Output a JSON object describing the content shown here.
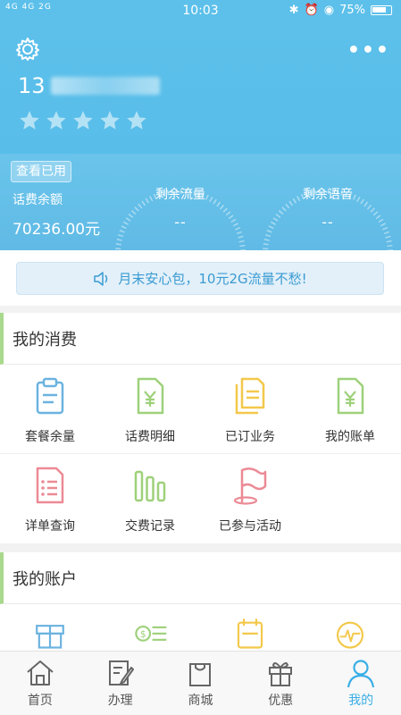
{
  "status_bar": {
    "signal": "4G 4G 2G",
    "time": "10:03",
    "battery": "75%"
  },
  "header": {
    "phone_visible": "13",
    "rating_stars": 5,
    "check_usage_label": "查看已用",
    "balance_label": "话费余额",
    "balance_value": "70236.00元",
    "data_label": "剩余流量",
    "data_value": "--",
    "voice_label": "剩余语音",
    "voice_value": "--"
  },
  "notice": {
    "text": "月末安心包，10元2G流量不愁!"
  },
  "consumption": {
    "title": "我的消费",
    "items": [
      {
        "label": "套餐余量",
        "icon": "clipboard-icon",
        "color": "#6bb3e0"
      },
      {
        "label": "话费明细",
        "icon": "yuan-document-icon",
        "color": "#9ed17a"
      },
      {
        "label": "已订业务",
        "icon": "documents-icon",
        "color": "#f3c84a"
      },
      {
        "label": "我的账单",
        "icon": "yuan-bill-icon",
        "color": "#9ed17a"
      },
      {
        "label": "详单查询",
        "icon": "list-document-icon",
        "color": "#ec8a95"
      },
      {
        "label": "交费记录",
        "icon": "bars-icon",
        "color": "#9ed17a"
      },
      {
        "label": "已参与活动",
        "icon": "flag-icon",
        "color": "#ec8a95"
      }
    ]
  },
  "account": {
    "title": "我的账户",
    "items": [
      {
        "icon": "gift-table-icon",
        "color": "#6bb3e0"
      },
      {
        "icon": "money-icon",
        "color": "#9ed17a"
      },
      {
        "icon": "calendar-icon",
        "color": "#f3c84a"
      },
      {
        "icon": "pulse-icon",
        "color": "#f3c84a"
      }
    ]
  },
  "tabbar": {
    "tabs": [
      {
        "label": "首页",
        "icon": "home-icon"
      },
      {
        "label": "办理",
        "icon": "edit-icon"
      },
      {
        "label": "商城",
        "icon": "bag-icon"
      },
      {
        "label": "优惠",
        "icon": "gift-icon"
      },
      {
        "label": "我的",
        "icon": "person-icon"
      }
    ],
    "active": "我的"
  },
  "colors": {
    "header": "#5cc0ea",
    "accent": "#3aaee6",
    "section_bar": "#a8d98c"
  }
}
